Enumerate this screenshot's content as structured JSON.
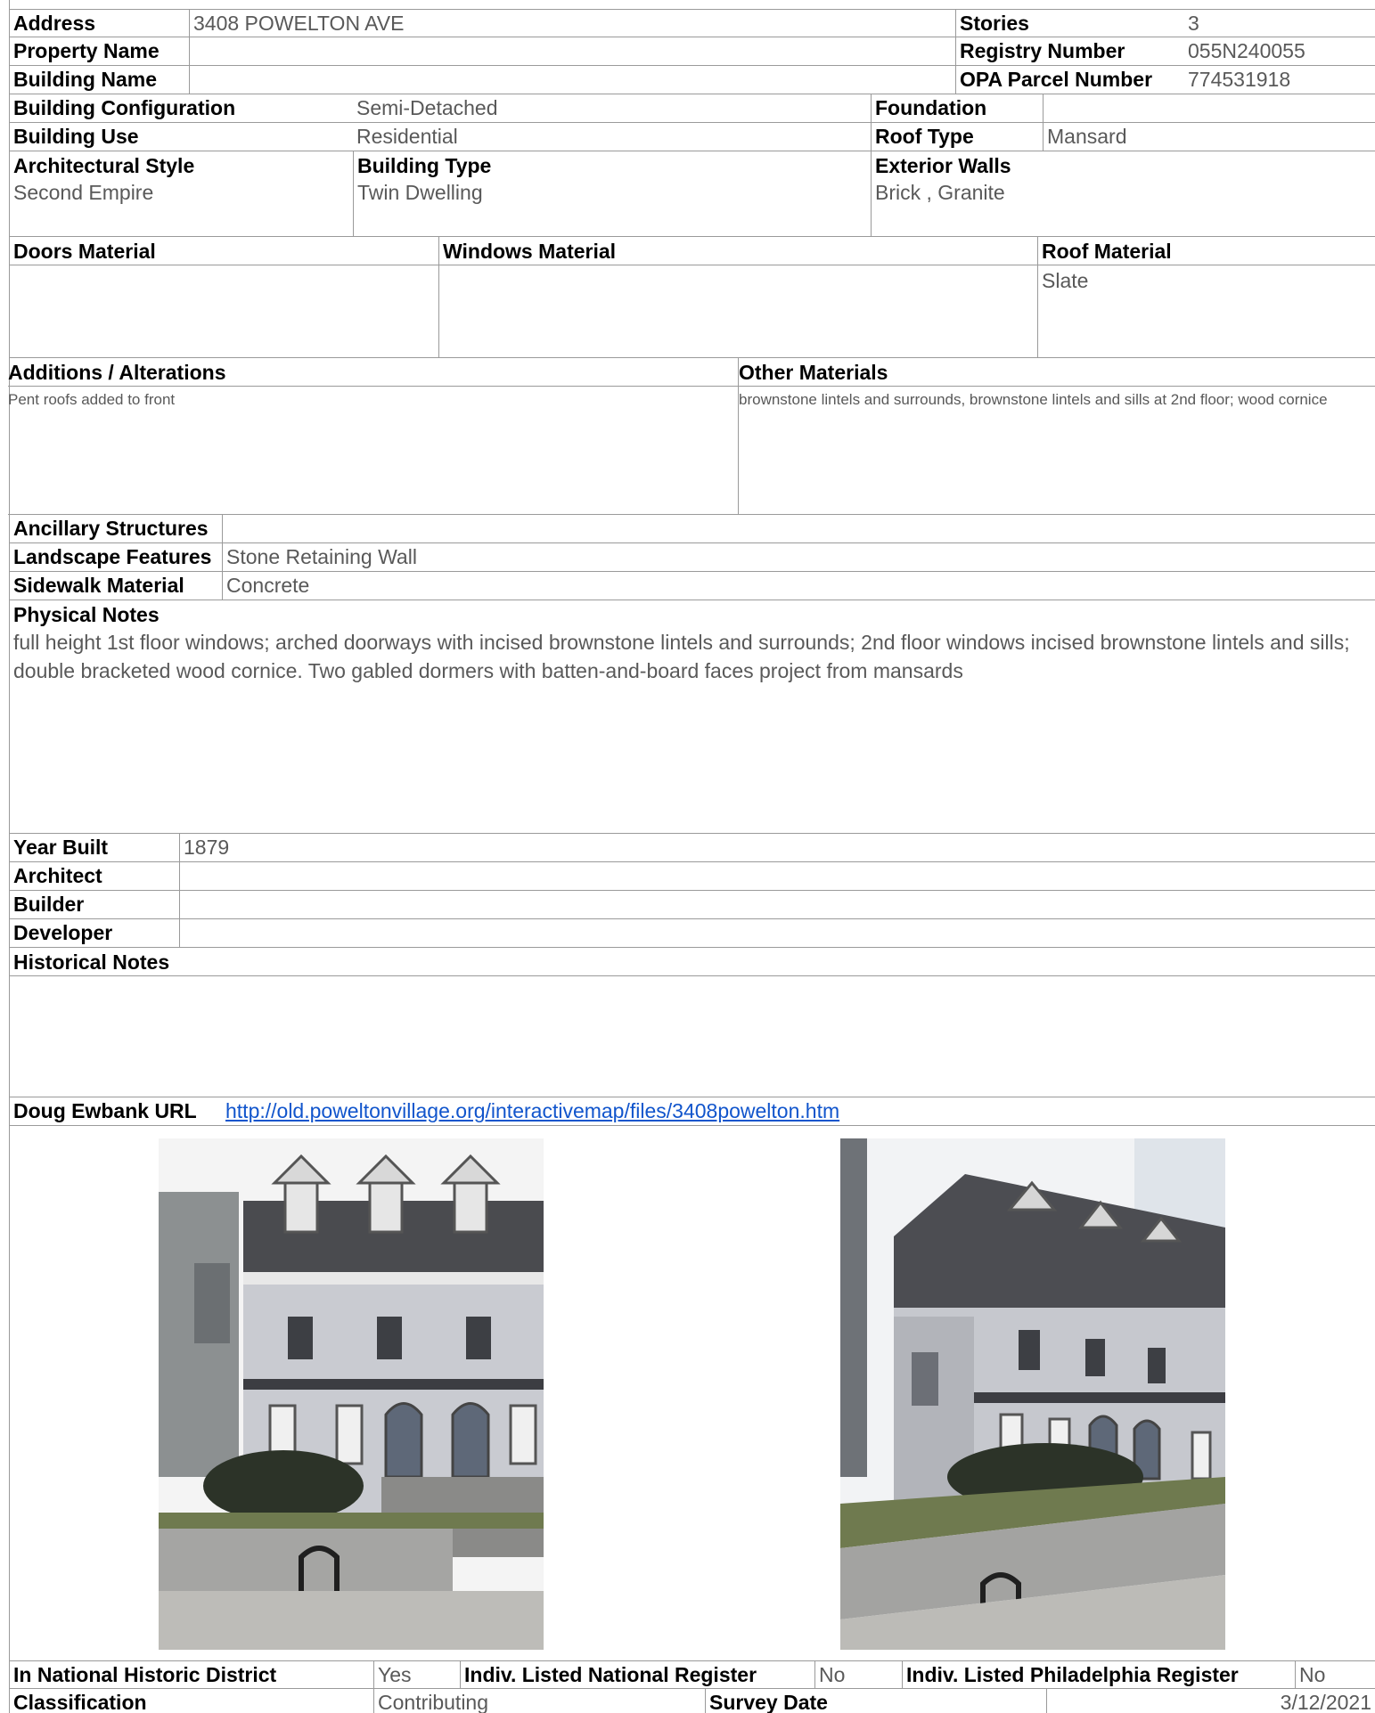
{
  "address": {
    "label": "Address",
    "value": "3408 POWELTON AVE"
  },
  "stories": {
    "label": "Stories",
    "value": "3"
  },
  "property_name": {
    "label": "Property Name",
    "value": ""
  },
  "registry_number": {
    "label": "Registry Number",
    "value": "055N240055"
  },
  "building_name": {
    "label": "Building Name",
    "value": ""
  },
  "opa_parcel": {
    "label": "OPA Parcel Number",
    "value": "774531918"
  },
  "building_configuration": {
    "label": "Building Configuration",
    "value": "Semi-Detached"
  },
  "foundation": {
    "label": "Foundation",
    "value": ""
  },
  "building_use": {
    "label": "Building Use",
    "value": "Residential"
  },
  "roof_type": {
    "label": "Roof Type",
    "value": "Mansard"
  },
  "architectural_style": {
    "label": "Architectural Style",
    "value": "Second Empire"
  },
  "building_type": {
    "label": "Building Type",
    "value": "Twin Dwelling"
  },
  "exterior_walls": {
    "label": "Exterior Walls",
    "value": "Brick , Granite"
  },
  "doors_material": {
    "label": "Doors Material",
    "value": ""
  },
  "windows_material": {
    "label": "Windows Material",
    "value": ""
  },
  "roof_material": {
    "label": "Roof Material",
    "value": "Slate"
  },
  "additions": {
    "label": "Additions / Alterations",
    "value": "Pent roofs added to front"
  },
  "other_materials": {
    "label": "Other Materials",
    "value": "brownstone lintels and surrounds, brownstone lintels and sills at 2nd floor; wood cornice"
  },
  "ancillary_structures": {
    "label": "Ancillary Structures",
    "value": ""
  },
  "landscape_features": {
    "label": "Landscape Features",
    "value": "Stone Retaining Wall"
  },
  "sidewalk_material": {
    "label": "Sidewalk Material",
    "value": "Concrete"
  },
  "physical_notes": {
    "label": "Physical Notes",
    "value": "full height 1st floor windows; arched doorways with incised brownstone lintels and surrounds; 2nd floor windows incised brownstone lintels and sills; double bracketed wood cornice. Two gabled dormers with batten-and-board faces project from mansards"
  },
  "year_built": {
    "label": "Year Built",
    "value": "1879"
  },
  "architect": {
    "label": "Architect",
    "value": ""
  },
  "builder": {
    "label": "Builder",
    "value": ""
  },
  "developer": {
    "label": "Developer",
    "value": ""
  },
  "historical_notes": {
    "label": "Historical Notes",
    "value": ""
  },
  "doug_ewbank": {
    "label": "Doug Ewbank URL",
    "value": "http://old.poweltonvillage.org/interactivemap/files/3408powelton.htm"
  },
  "photos": [
    {
      "name": "front-facade-photo"
    },
    {
      "name": "angled-facade-photo"
    }
  ],
  "national_district": {
    "label": "In National Historic District",
    "value": "Yes"
  },
  "national_register": {
    "label": "Indiv. Listed National Register",
    "value": "No"
  },
  "philadelphia_register": {
    "label": "Indiv. Listed Philadelphia Register",
    "value": "No"
  },
  "classification": {
    "label": "Classification",
    "value": "Contributing"
  },
  "survey_date": {
    "label": "Survey Date",
    "value": "3/12/2021"
  },
  "colors": {
    "border": "#9a9a9a",
    "value_text": "#595959",
    "link": "#1155cc"
  }
}
